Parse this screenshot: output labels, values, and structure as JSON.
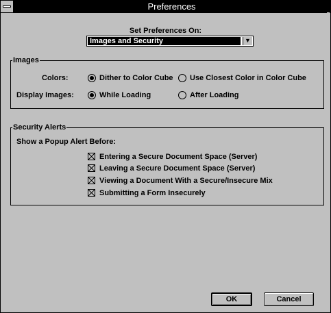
{
  "window": {
    "title": "Preferences"
  },
  "set_preferences": {
    "label": "Set Preferences On:",
    "selected": "Images and Security"
  },
  "images": {
    "group_title": "Images",
    "colors": {
      "label": "Colors:",
      "options": [
        "Dither to Color Cube",
        "Use Closest Color in Color Cube"
      ],
      "selected": "Dither to Color Cube"
    },
    "display": {
      "label": "Display Images:",
      "options": [
        "While Loading",
        "After Loading"
      ],
      "selected": "While Loading"
    }
  },
  "security": {
    "group_title": "Security Alerts",
    "intro": "Show a Popup Alert Before:",
    "alerts": [
      {
        "label": "Entering a Secure Document Space (Server)",
        "checked": true
      },
      {
        "label": "Leaving a Secure Document Space (Server)",
        "checked": true
      },
      {
        "label": "Viewing a Document With a Secure/Insecure Mix",
        "checked": true
      },
      {
        "label": "Submitting a Form Insecurely",
        "checked": true
      }
    ]
  },
  "buttons": {
    "ok": "OK",
    "cancel": "Cancel"
  }
}
